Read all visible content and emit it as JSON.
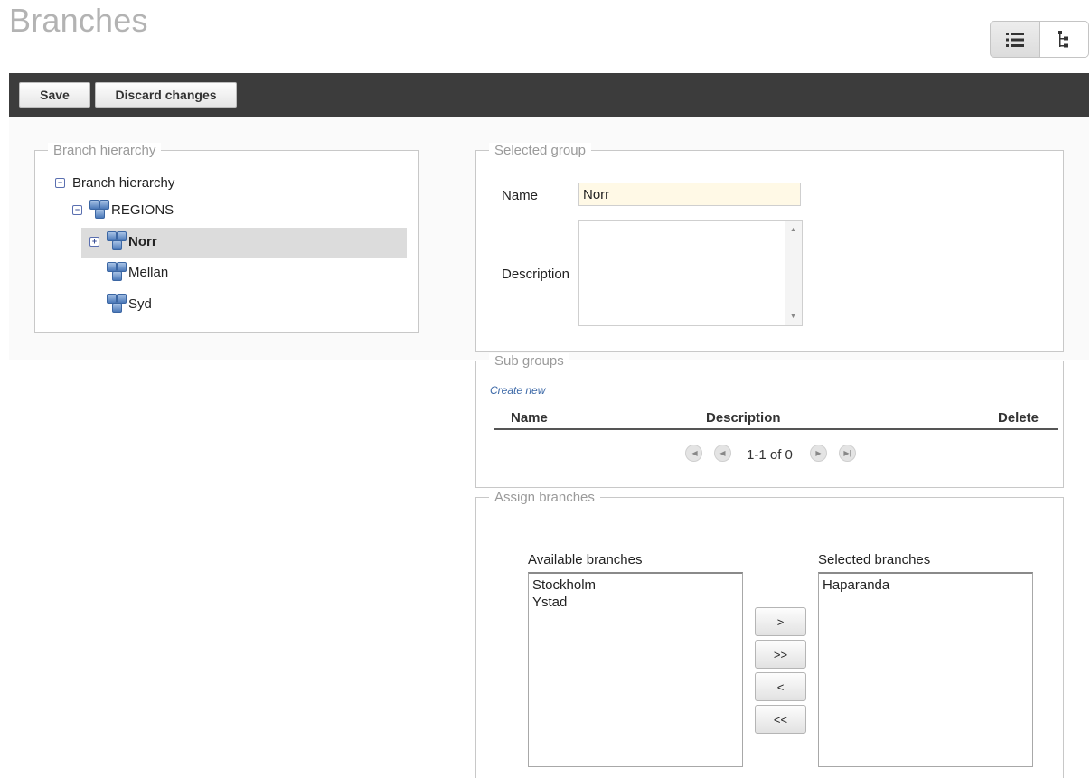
{
  "page": {
    "title": "Branches"
  },
  "view_switch": {
    "list_icon": "list-icon",
    "tree_icon": "tree-icon"
  },
  "toolbar": {
    "save_label": "Save",
    "discard_label": "Discard changes"
  },
  "hierarchy_panel": {
    "legend": "Branch hierarchy",
    "root": {
      "label": "Branch hierarchy",
      "toggle": "−"
    },
    "regions": {
      "label": "REGIONS",
      "toggle": "−"
    },
    "items": [
      {
        "label": "Norr",
        "toggle": "+",
        "selected": true
      },
      {
        "label": "Mellan"
      },
      {
        "label": "Syd"
      }
    ]
  },
  "selected_group": {
    "legend": "Selected group",
    "name_label": "Name",
    "name_value": "Norr",
    "description_label": "Description",
    "description_value": ""
  },
  "sub_groups": {
    "legend": "Sub groups",
    "create_new": "Create new",
    "columns": {
      "name": "Name",
      "description": "Description",
      "delete": "Delete"
    },
    "pager": {
      "text": "1-1 of 0"
    }
  },
  "assign_branches": {
    "legend": "Assign branches",
    "available_label": "Available branches",
    "available": [
      "Stockholm",
      "Ystad"
    ],
    "selected_label": "Selected branches",
    "selected": [
      "Haparanda"
    ],
    "buttons": {
      "add": ">",
      "add_all": ">>",
      "remove": "<",
      "remove_all": "<<"
    }
  }
}
